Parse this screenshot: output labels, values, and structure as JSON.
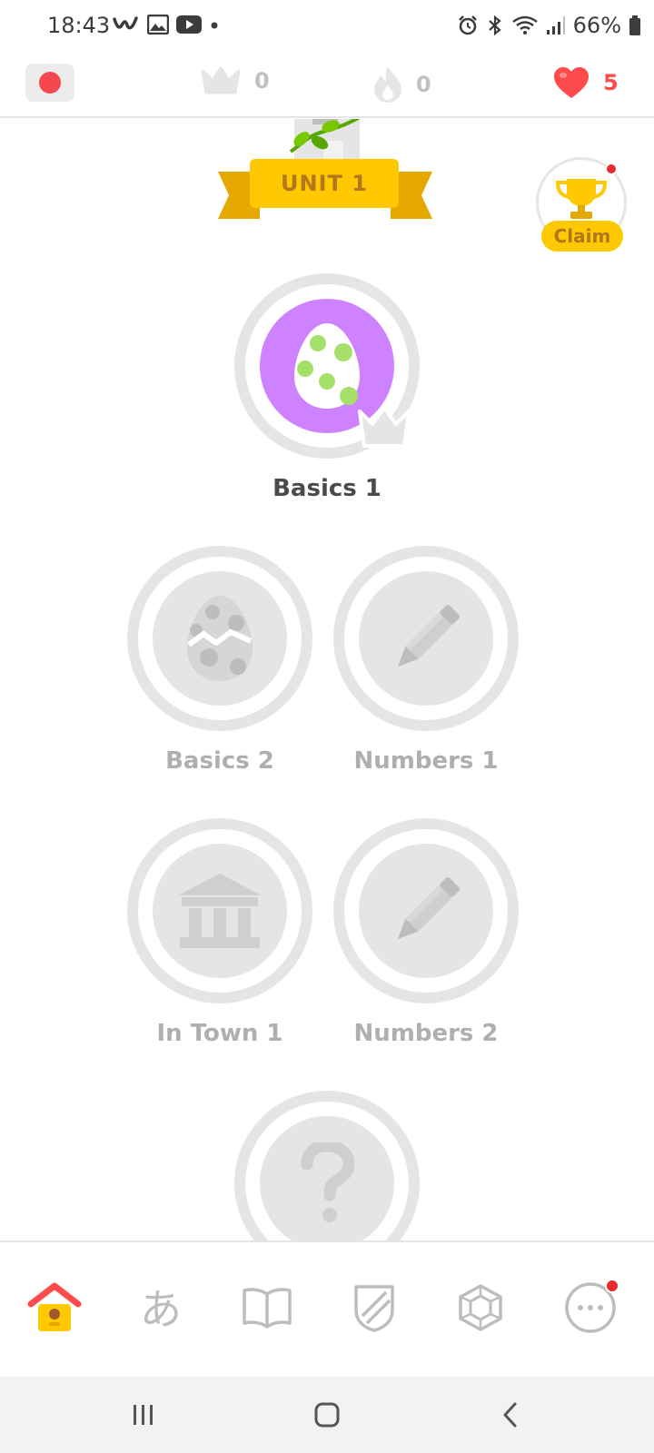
{
  "status_bar": {
    "time": "18:43",
    "battery": "66%",
    "left_icons": [
      "wish-icon",
      "image-icon",
      "youtube-icon",
      "dot-icon"
    ],
    "right_icons": [
      "alarm-icon",
      "bluetooth-icon",
      "wifi-icon",
      "signal-icon",
      "battery-icon"
    ]
  },
  "top_bar": {
    "flag_color": "#f5474e",
    "crowns": "0",
    "streak": "0",
    "hearts": "5"
  },
  "unit": {
    "label": "UNIT 1"
  },
  "claim": {
    "label": "Claim"
  },
  "skills": [
    {
      "label": "Basics 1",
      "icon": "egg-icon",
      "state": "active"
    },
    {
      "label": "Basics 2",
      "icon": "cracked-egg-icon",
      "state": "locked"
    },
    {
      "label": "Numbers 1",
      "icon": "pencil-icon",
      "state": "locked"
    },
    {
      "label": "In Town 1",
      "icon": "building-icon",
      "state": "locked"
    },
    {
      "label": "Numbers 2",
      "icon": "pencil-icon",
      "state": "locked"
    },
    {
      "label": "",
      "icon": "question-icon",
      "state": "locked"
    }
  ],
  "bottom_nav": [
    {
      "name": "home-icon",
      "active": true
    },
    {
      "name": "characters-icon",
      "active": false
    },
    {
      "name": "stories-icon",
      "active": false
    },
    {
      "name": "shield-icon",
      "active": false
    },
    {
      "name": "gem-icon",
      "active": false
    },
    {
      "name": "more-icon",
      "active": false,
      "badge": true
    }
  ],
  "colors": {
    "accent_gold": "#ffc800",
    "heart_red": "#ff4b4b",
    "active_skill": "#ce82ff",
    "locked_gray": "#e5e5e5"
  }
}
